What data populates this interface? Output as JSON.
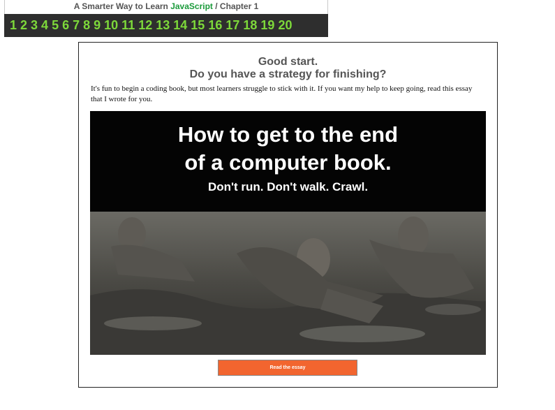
{
  "nav": {
    "prefix": "A Smarter Way to Learn ",
    "js": "JavaScript",
    "suffix": " / Chapter 1",
    "chapters": [
      "1",
      "2",
      "3",
      "4",
      "5",
      "6",
      "7",
      "8",
      "9",
      "10",
      "11",
      "12",
      "13",
      "14",
      "15",
      "16",
      "17",
      "18",
      "19",
      "20"
    ]
  },
  "panel": {
    "heading1": "Good start.",
    "heading2": "Do you have a strategy for finishing?",
    "body": "It's fun to begin a coding book, but most learners struggle to stick with it. If you want my help to keep going, read this essay that I wrote for you.",
    "hero": {
      "title_line1": "How to get to the end",
      "title_line2": "of a computer book.",
      "subtitle": "Don't run. Don't walk. Crawl."
    },
    "button": "Read the essay"
  },
  "colors": {
    "nav_bg": "#2e2e2e",
    "chapter_link": "#7dd83a",
    "js_green": "#1a9a3a",
    "button": "#f2652f"
  }
}
